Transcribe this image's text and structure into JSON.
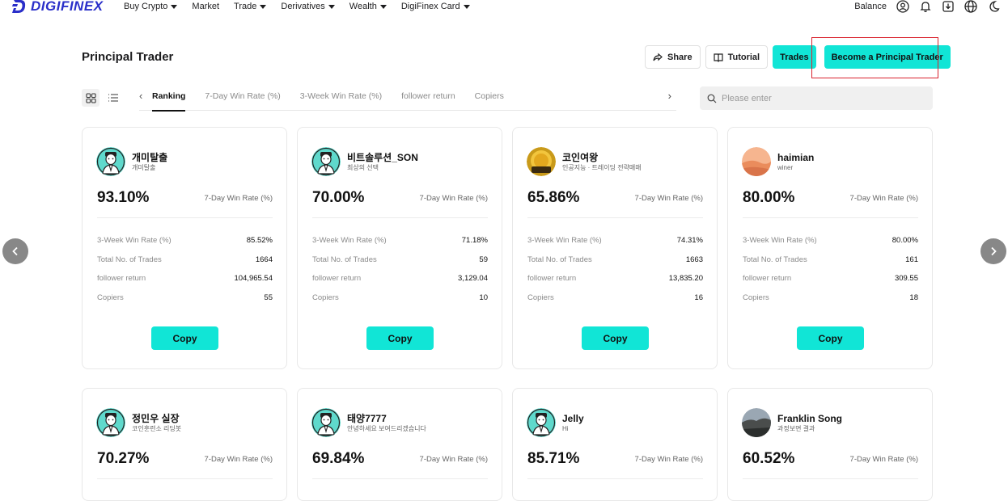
{
  "brand": {
    "name": "DIGIFINEX"
  },
  "nav": [
    {
      "label": "Buy Crypto",
      "has_caret": true
    },
    {
      "label": "Market",
      "has_caret": false
    },
    {
      "label": "Trade",
      "has_caret": true
    },
    {
      "label": "Derivatives",
      "has_caret": true
    },
    {
      "label": "Wealth",
      "has_caret": true
    },
    {
      "label": "DigiFinex Card",
      "has_caret": true
    }
  ],
  "topbar_right": {
    "balance_label": "Balance",
    "icons": [
      "user-icon",
      "bell-icon",
      "download-icon",
      "globe-icon",
      "moon-icon"
    ]
  },
  "page": {
    "title": "Principal Trader",
    "share_label": "Share",
    "tutorial_label": "Tutorial",
    "trades_label": "Trades",
    "become_label": "Become a Principal Trader"
  },
  "tabs": {
    "items": [
      "Ranking",
      "7-Day Win Rate (%)",
      "3-Week Win Rate (%)",
      "follower return",
      "Copiers"
    ],
    "active": "Ranking"
  },
  "search": {
    "placeholder": "Please enter",
    "value": ""
  },
  "colors": {
    "accent": "#11e5d6",
    "highlight": "#d9232e",
    "brand": "#2a2fc9"
  },
  "stat_labels": {
    "rate": "7-Day Win Rate (%)",
    "week3": "3-Week Win Rate (%)",
    "trades": "Total No. of Trades",
    "return": "follower return",
    "copiers": "Copiers"
  },
  "copy_label": "Copy",
  "traders": [
    {
      "name": "개미탈출",
      "subtitle": "개미탈출",
      "avatar": "default-avatar",
      "rate": "93.10%",
      "week3": "85.52%",
      "trades": "1664",
      "return": "104,965.54",
      "copiers": "55"
    },
    {
      "name": "비트솔루션_SON",
      "subtitle": "최상의 선택",
      "avatar": "default-avatar",
      "rate": "70.00%",
      "week3": "71.18%",
      "trades": "59",
      "return": "3,129.04",
      "copiers": "10"
    },
    {
      "name": "코인여왕",
      "subtitle": "인공지능 · 트레이딩 전략매매",
      "avatar": "gold-coin-avatar",
      "rate": "65.86%",
      "week3": "74.31%",
      "trades": "1663",
      "return": "13,835.20",
      "copiers": "16"
    },
    {
      "name": "haimian",
      "subtitle": "winer",
      "avatar": "desert-photo-avatar",
      "rate": "80.00%",
      "week3": "80.00%",
      "trades": "161",
      "return": "309.55",
      "copiers": "18"
    },
    {
      "name": "정민우 실장",
      "subtitle": "코인훈련소 리딩봇",
      "avatar": "default-avatar",
      "rate": "70.27%"
    },
    {
      "name": "태양7777",
      "subtitle": "안녕하세요 보여드리겠습니다",
      "avatar": "default-avatar",
      "rate": "69.84%"
    },
    {
      "name": "Jelly",
      "subtitle": "Hi",
      "avatar": "default-avatar",
      "rate": "85.71%"
    },
    {
      "name": "Franklin Song",
      "subtitle": "과정보면 결과",
      "avatar": "landscape-photo-avatar",
      "rate": "60.52%"
    }
  ]
}
